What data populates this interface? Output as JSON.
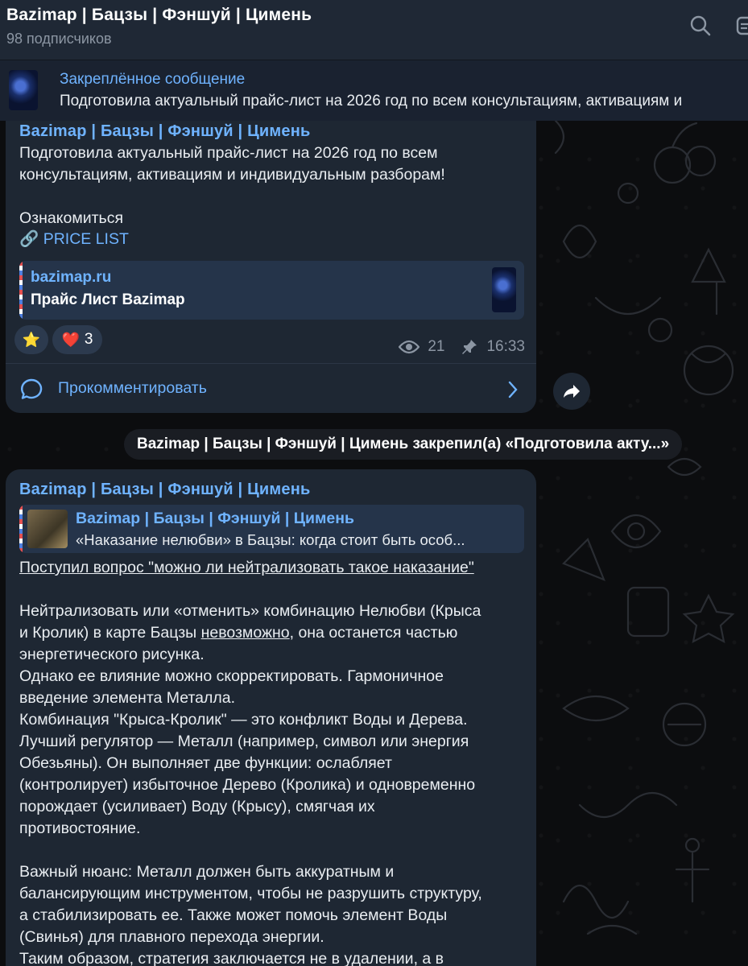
{
  "header": {
    "title": "Bazimap | Бацзы | Фэншуй | Цимень",
    "subscribers": "98 подписчиков"
  },
  "pinned": {
    "label": "Закреплённое сообщение",
    "text": "Подготовила актуальный прайс-лист на 2026 год по всем консультациям, активациям и"
  },
  "message1": {
    "author": "Bazimap | Бацзы | Фэншуй | Цимень",
    "text": "Подготовила актуальный прайс-лист на 2026 год по всем\nконсультациям, активациям и индивидуальным разборам!\n\nОзнакомиться",
    "link_emoji": "🔗",
    "link_text": "PRICE LIST",
    "preview": {
      "site": "bazimap.ru",
      "title": "Прайс Лист Bazimap"
    },
    "reactions": [
      {
        "emoji": "⭐",
        "count": ""
      },
      {
        "emoji": "❤️",
        "count": "3"
      }
    ],
    "views": "21",
    "time": "16:33",
    "comment_label": "Прокомментировать"
  },
  "service_message": "Bazimap | Бацзы | Фэншуй | Цимень закрепил(а) «Подготовила акту...»",
  "message2": {
    "author": "Bazimap | Бацзы | Фэншуй | Цимень",
    "quote": {
      "author": "Bazimap | Бацзы | Фэншуй | Цимень",
      "text": "«Наказание нелюбви» в Бацзы: когда стоит быть особ..."
    },
    "question": "Поступил вопрос \"можно ли нейтрализовать такое наказание\"",
    "p1_a": "Нейтрализовать или «отменить» комбинацию Нелюбви (Крыса\nи Кролик) в карте Бацзы ",
    "p1_u": "невозможно",
    "p1_b": ", она останется частью\nэнергетического рисунка.",
    "body": "Однако ее влияние можно скорректировать. Гармоничное\nвведение элемента Металла.\nКомбинация \"Крыса-Кролик\" — это конфликт Воды и Дерева.\nЛучший регулятор — Металл (например, символ или энергия\nОбезьяны). Он выполняет две функции: ослабляет\n(контролирует) избыточное Дерево (Кролика) и одновременно\nпорождает (усиливает) Воду (Крысу), смягчая их\nпротивостояние.\n\nВажный нюанс: Металл должен быть аккуратным и\nбалансирующим инструментом, чтобы не разрушить структуру,\nа стабилизировать ее. Также может помочь элемент Воды\n(Свинья) для плавного перехода энергии.\nТаким образом, стратегия заключается не в удалении, а в"
  },
  "colors": {
    "accent": "#6fb3ff",
    "bubble": "#1e2733",
    "header": "#1f2835"
  }
}
